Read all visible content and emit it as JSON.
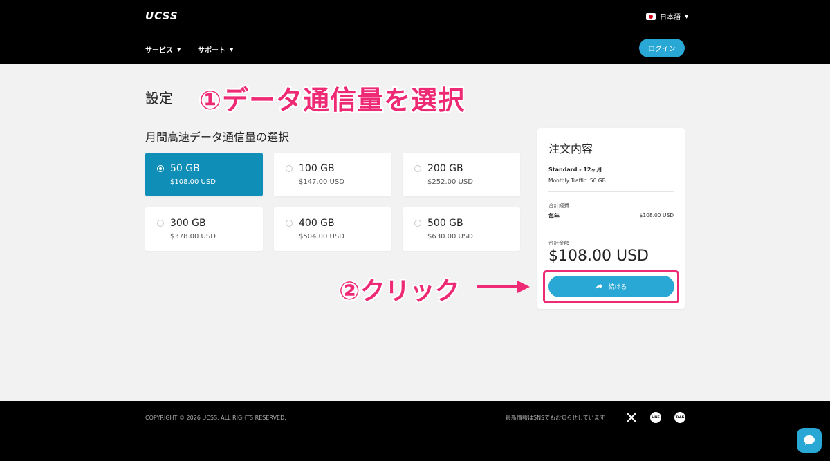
{
  "header": {
    "logo": "UCSS",
    "language": "日本語",
    "nav": [
      {
        "label": "サービス"
      },
      {
        "label": "サポート"
      }
    ],
    "login_label": "ログイン"
  },
  "main": {
    "title": "設定",
    "annotation_1": "①データ通信量を選択",
    "selection_heading": "月間高速データ通信量の選択",
    "plans": [
      {
        "gb": "50 GB",
        "price": "$108.00 USD",
        "selected": true
      },
      {
        "gb": "100 GB",
        "price": "$147.00 USD",
        "selected": false
      },
      {
        "gb": "200 GB",
        "price": "$252.00 USD",
        "selected": false
      },
      {
        "gb": "300 GB",
        "price": "$378.00 USD",
        "selected": false
      },
      {
        "gb": "400 GB",
        "price": "$504.00 USD",
        "selected": false
      },
      {
        "gb": "500 GB",
        "price": "$630.00 USD",
        "selected": false
      }
    ],
    "annotation_2": "②クリック"
  },
  "order": {
    "title": "注文内容",
    "plan_line": "Standard - 12ヶ月",
    "traffic_line": "Monthly Traffic: 50 GB",
    "subtotal_label": "合計経費",
    "yearly_label": "毎年",
    "yearly_amount": "$108.00 USD",
    "total_label": "合計金額",
    "total_amount": "$108.00 USD",
    "continue_label": "続ける"
  },
  "footer": {
    "copyright": "COPYRIGHT © 2026 UCSS. ALL RIGHTS RESERVED.",
    "sns_text": "最新情報はSNSでもお知らせしています",
    "line_icon_text": "LINE",
    "talk_icon_text": "TALK"
  },
  "colors": {
    "accent": "#29a8d6",
    "selected_plan": "#0f8fb8",
    "annotation": "#ee2a75"
  }
}
